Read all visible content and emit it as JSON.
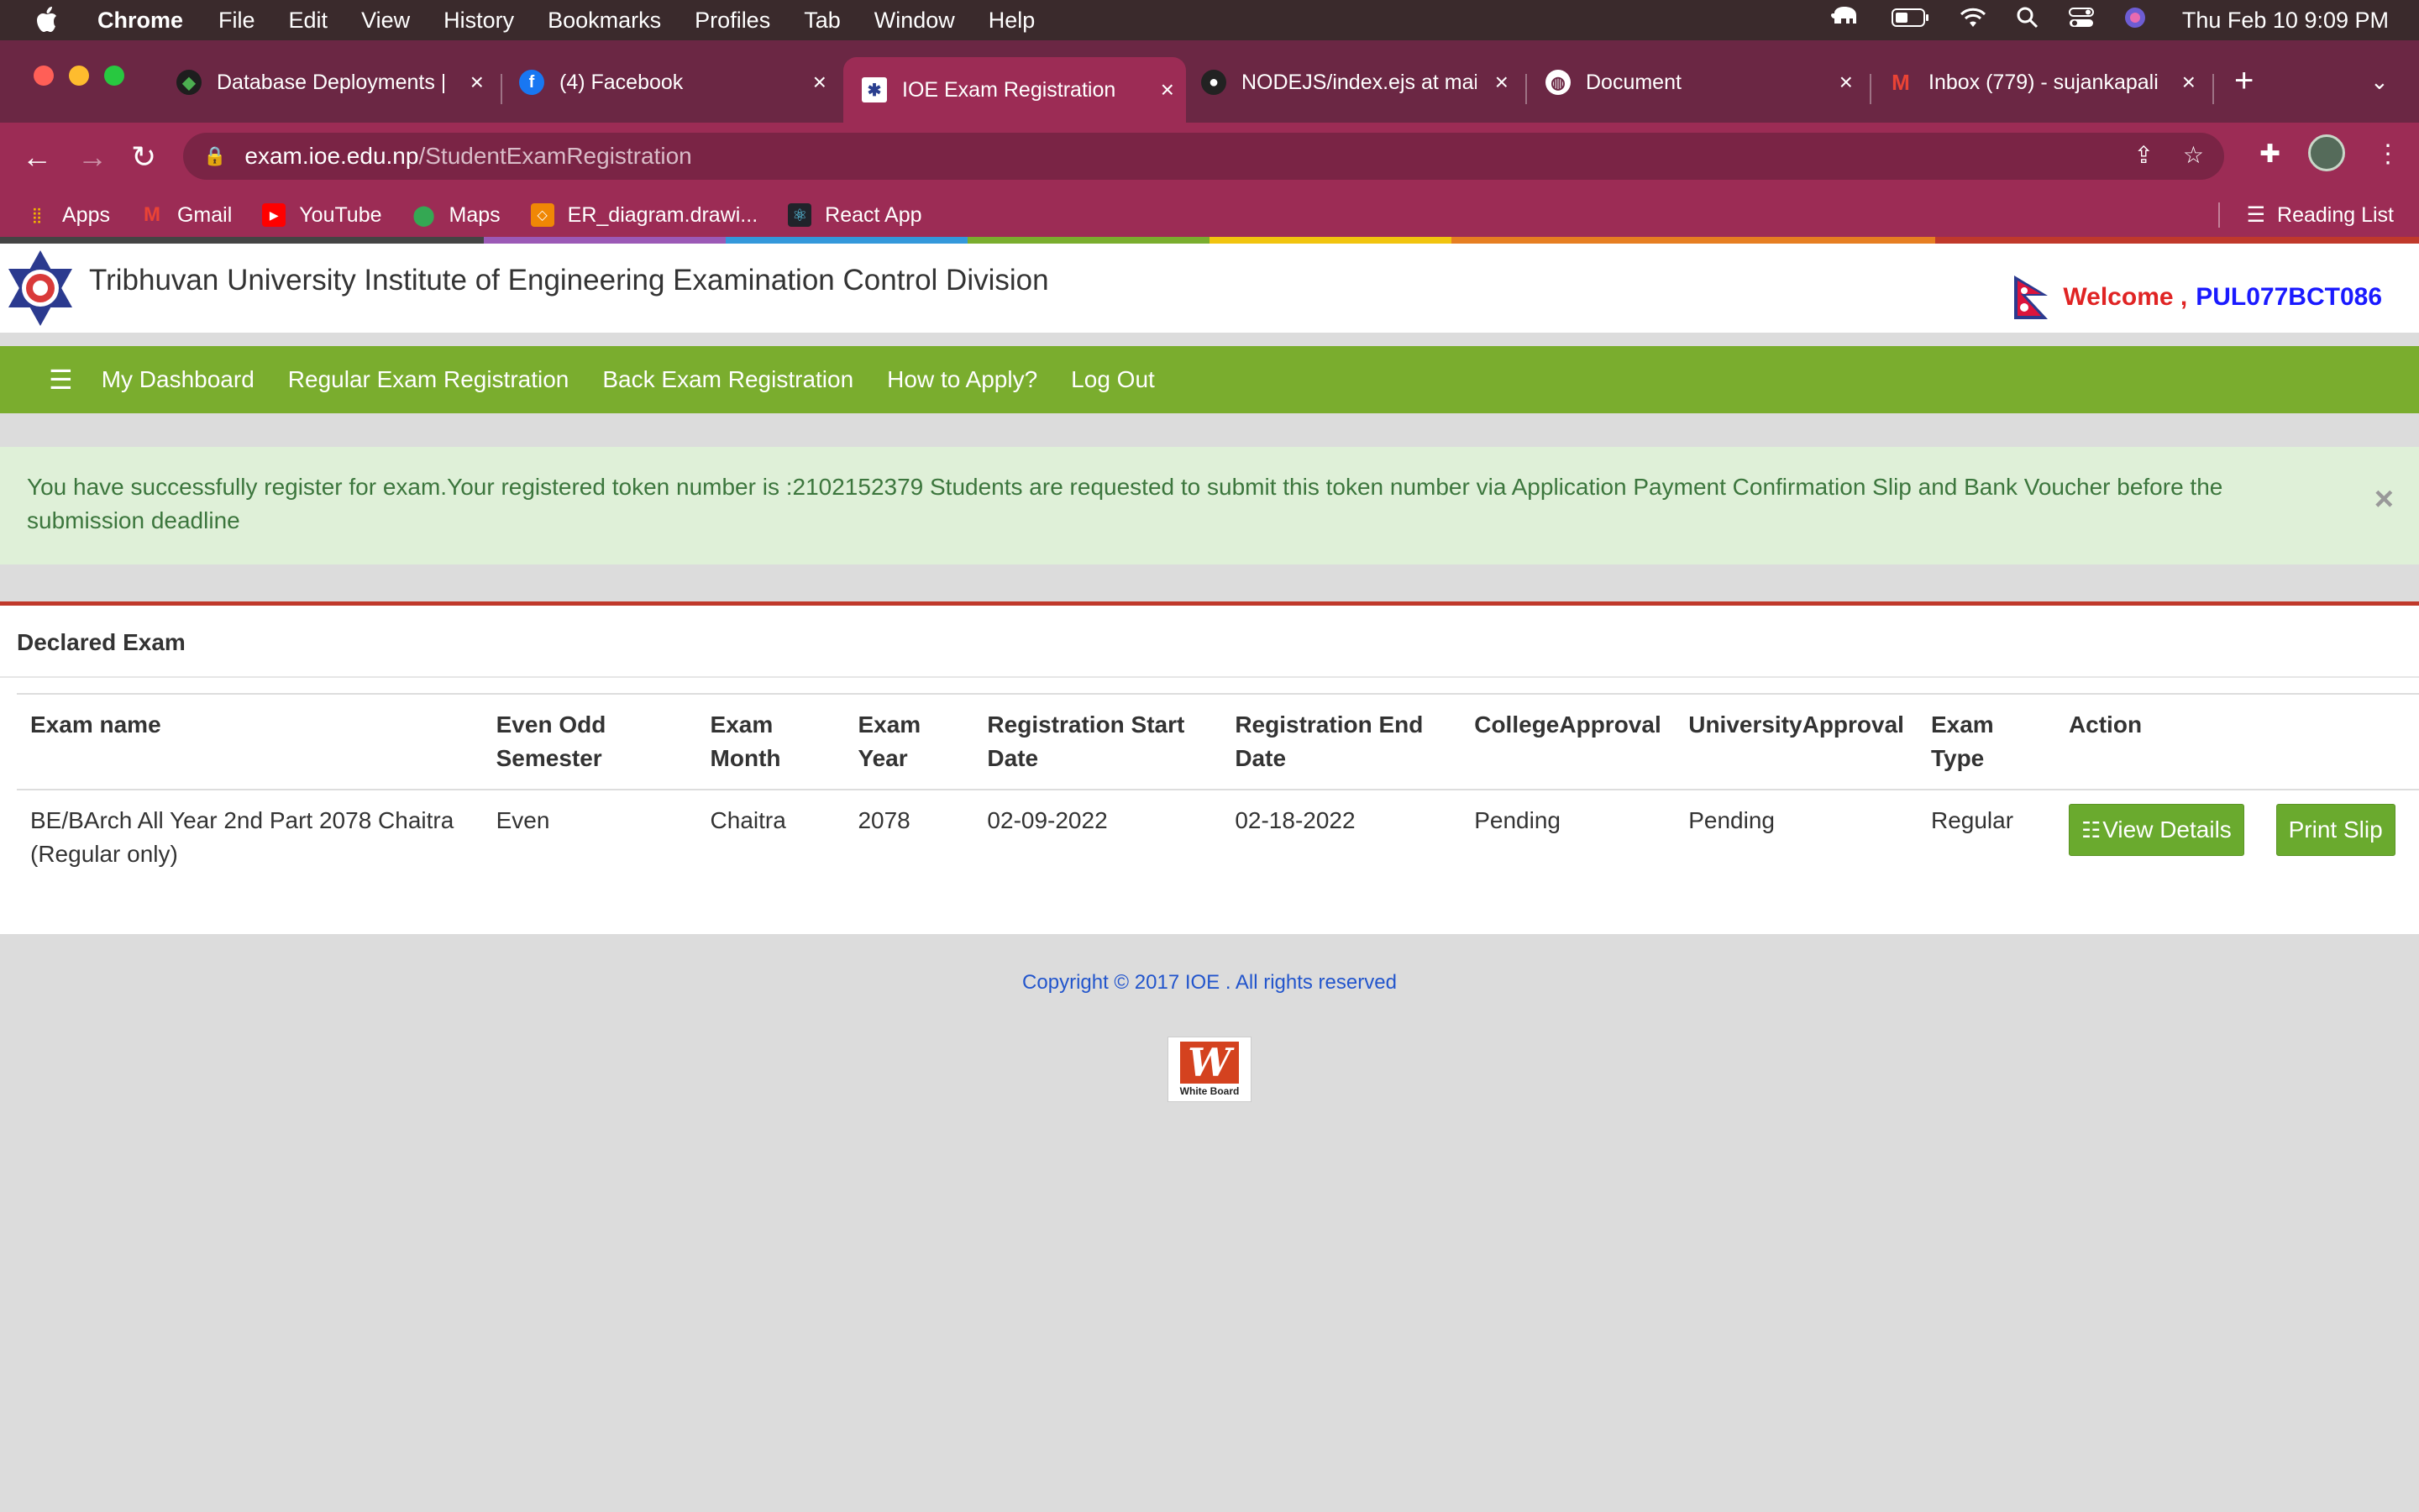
{
  "menubar": {
    "app": "Chrome",
    "items": [
      "File",
      "Edit",
      "View",
      "History",
      "Bookmarks",
      "Profiles",
      "Tab",
      "Window",
      "Help"
    ],
    "clock": "Thu Feb 10  9:09 PM"
  },
  "tabs": [
    {
      "title": "Database Deployments |",
      "icon": "mongodb-leaf-icon"
    },
    {
      "title": "(4) Facebook",
      "icon": "facebook-icon"
    },
    {
      "title": "IOE Exam Registration",
      "icon": "ioe-icon",
      "active": true
    },
    {
      "title": "NODEJS/index.ejs at mai",
      "icon": "github-icon"
    },
    {
      "title": "Document",
      "icon": "globe-icon"
    },
    {
      "title": "Inbox (779) - sujankapali",
      "icon": "gmail-icon"
    }
  ],
  "address": {
    "host": "exam.ioe.edu.np",
    "path": "/StudentExamRegistration"
  },
  "bookmarks": [
    {
      "label": "Apps",
      "icon": "apps-grid-icon"
    },
    {
      "label": "Gmail",
      "icon": "gmail-icon"
    },
    {
      "label": "YouTube",
      "icon": "youtube-icon"
    },
    {
      "label": "Maps",
      "icon": "maps-icon"
    },
    {
      "label": "ER_diagram.drawi...",
      "icon": "drawio-icon"
    },
    {
      "label": "React App",
      "icon": "react-icon"
    }
  ],
  "reading_list": "Reading List",
  "site": {
    "title": "Tribhuvan University Institute of Engineering Examination Control Division",
    "welcome": "Welcome ,",
    "user": "PUL077BCT086"
  },
  "nav": {
    "items": [
      "My Dashboard",
      "Regular Exam Registration",
      "Back Exam Registration",
      "How to Apply?",
      "Log Out"
    ]
  },
  "alert": {
    "message": "You have successfully register for exam.Your registered token number is :2102152379 Students are requested to submit this token number via Application Payment Confirmation Slip and Bank Voucher before the submission deadline",
    "close": "×"
  },
  "panel": {
    "title": "Declared Exam",
    "columns": [
      "Exam name",
      "Even Odd Semester",
      "Exam Month",
      "Exam Year",
      "Registration Start Date",
      "Registration End Date",
      "CollegeApproval",
      "UniversityApproval",
      "Exam Type",
      "Action"
    ],
    "rows": [
      {
        "exam_name": "BE/BArch All Year 2nd Part 2078 Chaitra (Regular only)",
        "semester": "Even",
        "month": "Chaitra",
        "year": "2078",
        "start": "02-09-2022",
        "end": "02-18-2022",
        "college": "Pending",
        "university": "Pending",
        "type": "Regular",
        "view_label": "View Details",
        "print_label": "Print Slip"
      }
    ]
  },
  "footer": {
    "copyright": "Copyright © 2017 IOE . All rights reserved",
    "logo_text": "White Board"
  },
  "colors": {
    "nav_green": "#7aad2e",
    "alert_bg": "#dff0d8",
    "alert_text": "#3c763d",
    "welcome_red": "#e02424",
    "user_blue": "#1a1aff",
    "tab_active": "#9c2c55"
  }
}
